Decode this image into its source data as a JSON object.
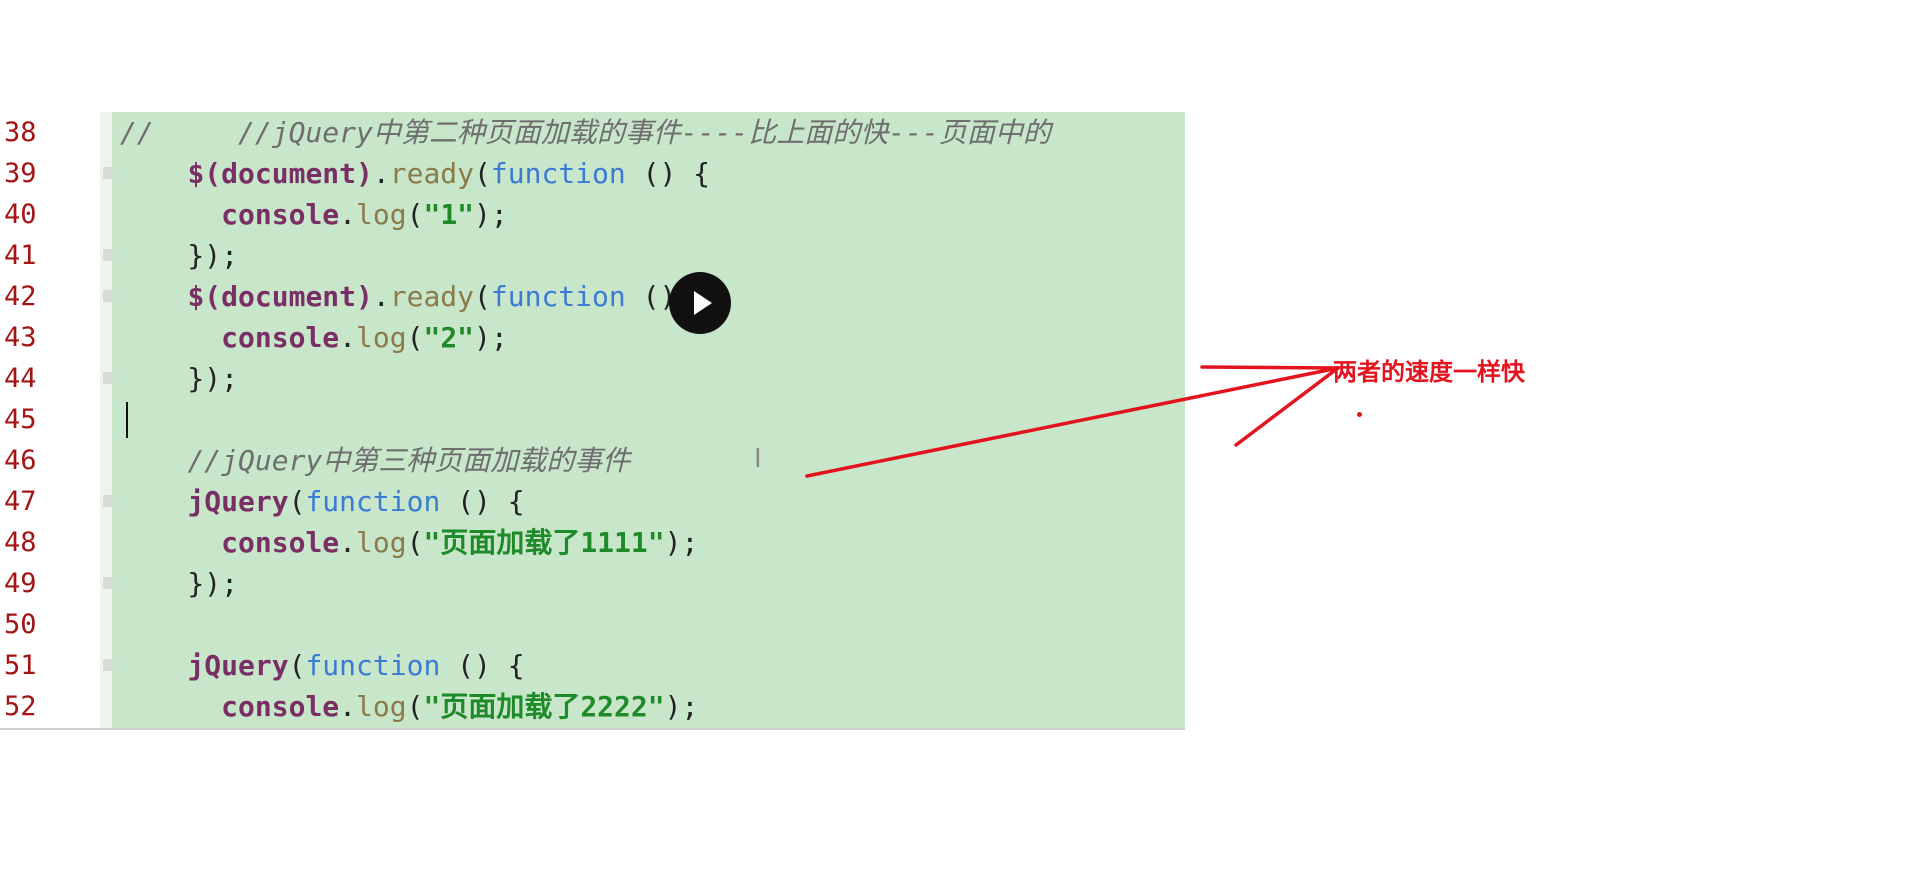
{
  "editor": {
    "lines": [
      {
        "num": "38",
        "parts": [
          {
            "t": "//     //jQuery中第二种页面加载的事件----比上面的快---页面中的",
            "c": "comment"
          }
        ]
      },
      {
        "num": "39",
        "parts": [
          {
            "t": "    ",
            "c": "punct"
          },
          {
            "t": "$(document)",
            "c": "fn"
          },
          {
            "t": ".",
            "c": "punct"
          },
          {
            "t": "ready",
            "c": "method"
          },
          {
            "t": "(",
            "c": "punct"
          },
          {
            "t": "function",
            "c": "kw"
          },
          {
            "t": " () {",
            "c": "punct"
          }
        ]
      },
      {
        "num": "40",
        "parts": [
          {
            "t": "      ",
            "c": "punct"
          },
          {
            "t": "console",
            "c": "fn"
          },
          {
            "t": ".",
            "c": "punct"
          },
          {
            "t": "log",
            "c": "method"
          },
          {
            "t": "(",
            "c": "punct"
          },
          {
            "t": "\"1\"",
            "c": "str"
          },
          {
            "t": ");",
            "c": "punct"
          }
        ]
      },
      {
        "num": "41",
        "parts": [
          {
            "t": "    });",
            "c": "punct"
          }
        ]
      },
      {
        "num": "42",
        "parts": [
          {
            "t": "    ",
            "c": "punct"
          },
          {
            "t": "$(document)",
            "c": "fn"
          },
          {
            "t": ".",
            "c": "punct"
          },
          {
            "t": "ready",
            "c": "method"
          },
          {
            "t": "(",
            "c": "punct"
          },
          {
            "t": "function",
            "c": "kw"
          },
          {
            "t": " () {",
            "c": "punct"
          }
        ]
      },
      {
        "num": "43",
        "parts": [
          {
            "t": "      ",
            "c": "punct"
          },
          {
            "t": "console",
            "c": "fn"
          },
          {
            "t": ".",
            "c": "punct"
          },
          {
            "t": "log",
            "c": "method"
          },
          {
            "t": "(",
            "c": "punct"
          },
          {
            "t": "\"2\"",
            "c": "str"
          },
          {
            "t": ");",
            "c": "punct"
          }
        ]
      },
      {
        "num": "44",
        "parts": [
          {
            "t": "    });",
            "c": "punct"
          }
        ]
      },
      {
        "num": "45",
        "parts": []
      },
      {
        "num": "46",
        "parts": [
          {
            "t": "    ",
            "c": "punct"
          },
          {
            "t": "//jQuery中第三种页面加载的事件",
            "c": "comment"
          }
        ]
      },
      {
        "num": "47",
        "parts": [
          {
            "t": "    ",
            "c": "punct"
          },
          {
            "t": "jQuery",
            "c": "fn"
          },
          {
            "t": "(",
            "c": "punct"
          },
          {
            "t": "function",
            "c": "kw"
          },
          {
            "t": " () {",
            "c": "punct"
          }
        ]
      },
      {
        "num": "48",
        "parts": [
          {
            "t": "      ",
            "c": "punct"
          },
          {
            "t": "console",
            "c": "fn"
          },
          {
            "t": ".",
            "c": "punct"
          },
          {
            "t": "log",
            "c": "method"
          },
          {
            "t": "(",
            "c": "punct"
          },
          {
            "t": "\"页面加载了1111\"",
            "c": "str"
          },
          {
            "t": ");",
            "c": "punct"
          }
        ]
      },
      {
        "num": "49",
        "parts": [
          {
            "t": "    });",
            "c": "punct"
          }
        ]
      },
      {
        "num": "50",
        "parts": []
      },
      {
        "num": "51",
        "parts": [
          {
            "t": "    ",
            "c": "punct"
          },
          {
            "t": "jQuery",
            "c": "fn"
          },
          {
            "t": "(",
            "c": "punct"
          },
          {
            "t": "function",
            "c": "kw"
          },
          {
            "t": " () {",
            "c": "punct"
          }
        ]
      },
      {
        "num": "52",
        "parts": [
          {
            "t": "      ",
            "c": "punct"
          },
          {
            "t": "console",
            "c": "fn"
          },
          {
            "t": ".",
            "c": "punct"
          },
          {
            "t": "log",
            "c": "method"
          },
          {
            "t": "(",
            "c": "punct"
          },
          {
            "t": "\"页面加载了2222\"",
            "c": "str"
          },
          {
            "t": ");",
            "c": "punct"
          }
        ]
      }
    ],
    "caret_line": "45",
    "folded_lines": [
      "39",
      "41",
      "42",
      "44",
      "47",
      "49",
      "51"
    ]
  },
  "annotation": {
    "text": "两者的速度一样快",
    "color": "#e3141e"
  },
  "icons": {
    "play": "play-icon",
    "text_cursor": "text-cursor-icon"
  },
  "colors": {
    "code_background": "#c8e6c9",
    "line_number": "#a31515",
    "keyword": "#3b7bd6",
    "string": "#1f8a2a",
    "comment": "#6e6e6e"
  }
}
